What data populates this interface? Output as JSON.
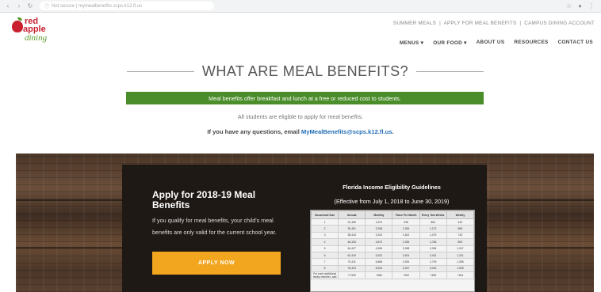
{
  "browser": {
    "nav_icons": [
      "back-icon",
      "forward-icon",
      "reload-icon"
    ],
    "url": "Not secure | mymealbenefits.scps.k12.fl.us",
    "right_icons": [
      "star-icon",
      "profile-icon",
      "menu-dots-icon"
    ]
  },
  "logo": {
    "word1": "red",
    "word2": "apple",
    "word3": "dining"
  },
  "toplinks": {
    "items": [
      "SUMMER MEALS",
      "APPLY FOR MEAL BENEFITS",
      "CAMPUS DINING ACCOUNT"
    ],
    "separator": "|"
  },
  "mainnav": {
    "items": [
      "MENUS ▾",
      "OUR FOOD ▾",
      "ABOUT US",
      "RESOURCES",
      "CONTACT US"
    ]
  },
  "hero": {
    "title": "WHAT ARE MEAL BENEFITS?",
    "banner": "Meal benefits offer breakfast and lunch at a free or reduced cost to students.",
    "eligible": "All students are eligible to apply for meal benefits.",
    "question_prefix": "If you have any questions, email ",
    "email": "MyMealBenefits@scps.k12.fl.us",
    "question_suffix": "."
  },
  "apply": {
    "title": "Apply for 2018-19 Meal Benefits",
    "body": "If you qualify for meal benefits, your child's meal benefits are only valid for the current school year.",
    "button": "APPLY NOW"
  },
  "guidelines": {
    "title": "Florida Income Eligibility Guidelines",
    "subtitle": "(Effective from July 1, 2018 to June 30, 2019)",
    "headers": [
      "Household Size",
      "Annual",
      "Monthly",
      "Twice Per Month",
      "Every Two Weeks",
      "Weekly"
    ],
    "rows": [
      [
        "1",
        "22,459",
        "1,872",
        "936",
        "864",
        "432"
      ],
      [
        "2",
        "30,451",
        "2,538",
        "1,269",
        "1,172",
        "586"
      ],
      [
        "3",
        "38,443",
        "3,204",
        "1,602",
        "1,479",
        "740"
      ],
      [
        "4",
        "46,435",
        "3,870",
        "1,935",
        "1,786",
        "893"
      ],
      [
        "5",
        "54,427",
        "4,536",
        "2,268",
        "2,094",
        "1,047"
      ],
      [
        "6",
        "62,419",
        "5,202",
        "2,601",
        "2,401",
        "1,201"
      ],
      [
        "7",
        "70,411",
        "5,868",
        "2,934",
        "2,709",
        "1,355"
      ],
      [
        "8",
        "78,403",
        "6,534",
        "3,267",
        "3,016",
        "1,508"
      ],
      [
        "For each additional family member, add",
        "+7,992",
        "+666",
        "+333",
        "+308",
        "+154"
      ]
    ]
  }
}
